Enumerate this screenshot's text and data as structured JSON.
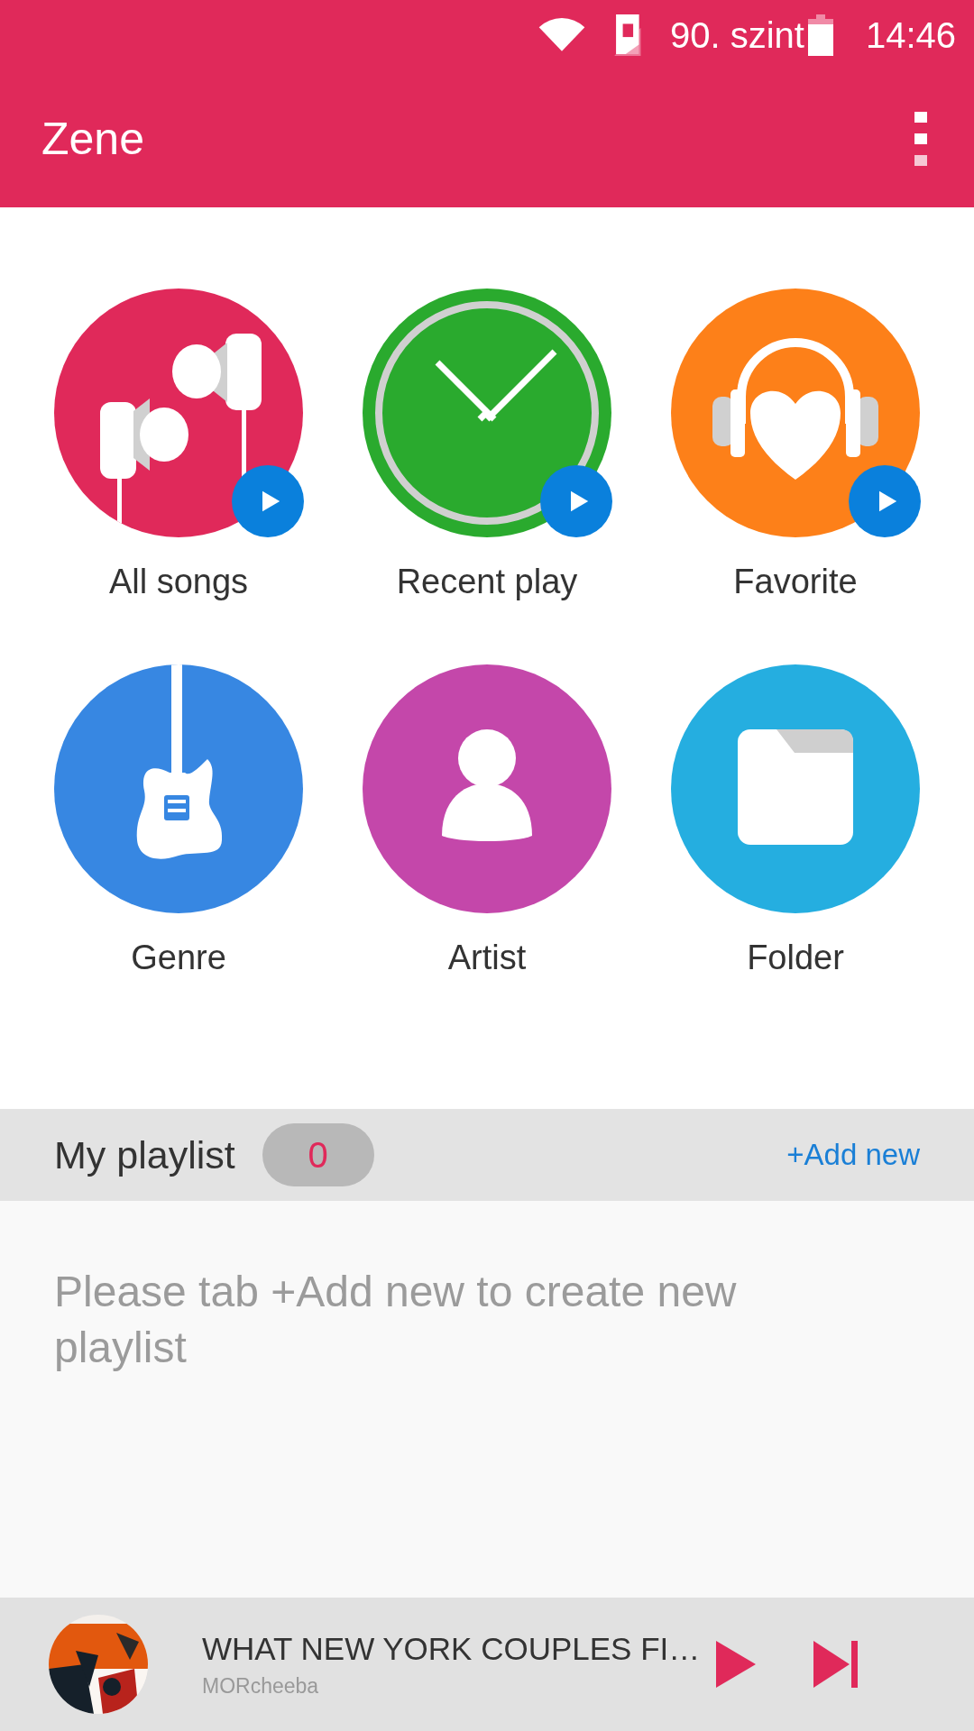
{
  "status_bar": {
    "carrier": "90. szint",
    "time": "14:46"
  },
  "app_bar": {
    "title": "Zene"
  },
  "categories": [
    {
      "label": "All songs",
      "kind": "earphones",
      "color": "#e0295a",
      "play": true
    },
    {
      "label": "Recent play",
      "kind": "clock",
      "color": "#2aaa2e",
      "play": true
    },
    {
      "label": "Favorite",
      "kind": "headphones",
      "color": "#fd8019",
      "play": true
    },
    {
      "label": "Genre",
      "kind": "guitar",
      "color": "#3787e2",
      "play": false
    },
    {
      "label": "Artist",
      "kind": "person",
      "color": "#c447aa",
      "play": false
    },
    {
      "label": "Folder",
      "kind": "folder",
      "color": "#25aee0",
      "play": false
    }
  ],
  "playlist": {
    "title": "My playlist",
    "count": "0",
    "add_link": "+Add new",
    "message": "Please tab +Add new to create new playlist"
  },
  "now_playing": {
    "title": "WHAT NEW YORK COUPLES FI…",
    "artist": "MORcheeba"
  }
}
